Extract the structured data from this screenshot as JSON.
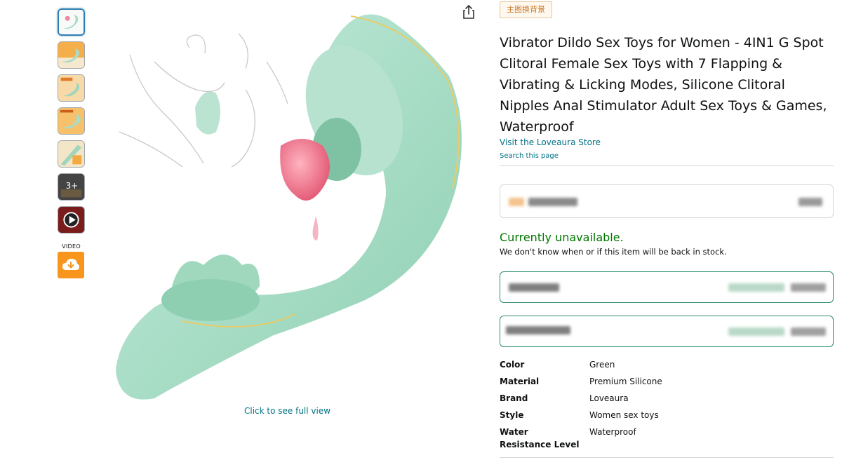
{
  "badge": {
    "label": "主图换背景"
  },
  "product": {
    "title": "Vibrator Dildo Sex Toys for Women - 4IN1 G Spot Clitoral Female Sex Toys with 7 Flapping & Vibrating & Licking Modes, Silicone Clitoral Nipples Anal Stimulator Adult Sex Toys & Games, Waterproof",
    "store_link": "Visit the Loveaura Store",
    "search_link": "Search this page"
  },
  "gallery": {
    "thumbnail_3_text": "3+",
    "video_label": "VIDEO",
    "full_view_link": "Click to see full view"
  },
  "availability": {
    "status": "Currently unavailable.",
    "message": "We don't know when or if this item will be back in stock."
  },
  "specs": [
    {
      "key": "Color",
      "value": "Green"
    },
    {
      "key": "Material",
      "value": "Premium Silicone"
    },
    {
      "key": "Brand",
      "value": "Loveaura"
    },
    {
      "key": "Style",
      "value": "Women sex toys"
    },
    {
      "key": "Water Resistance Level",
      "value": "Waterproof"
    }
  ],
  "colors": {
    "accent_link": "#007185",
    "available_green": "#007600",
    "product_mint": "#a9dcc6",
    "download_orange": "#f7951d"
  },
  "icons": {
    "share": "share-icon",
    "download": "cloud-download-icon",
    "play": "play-icon"
  }
}
